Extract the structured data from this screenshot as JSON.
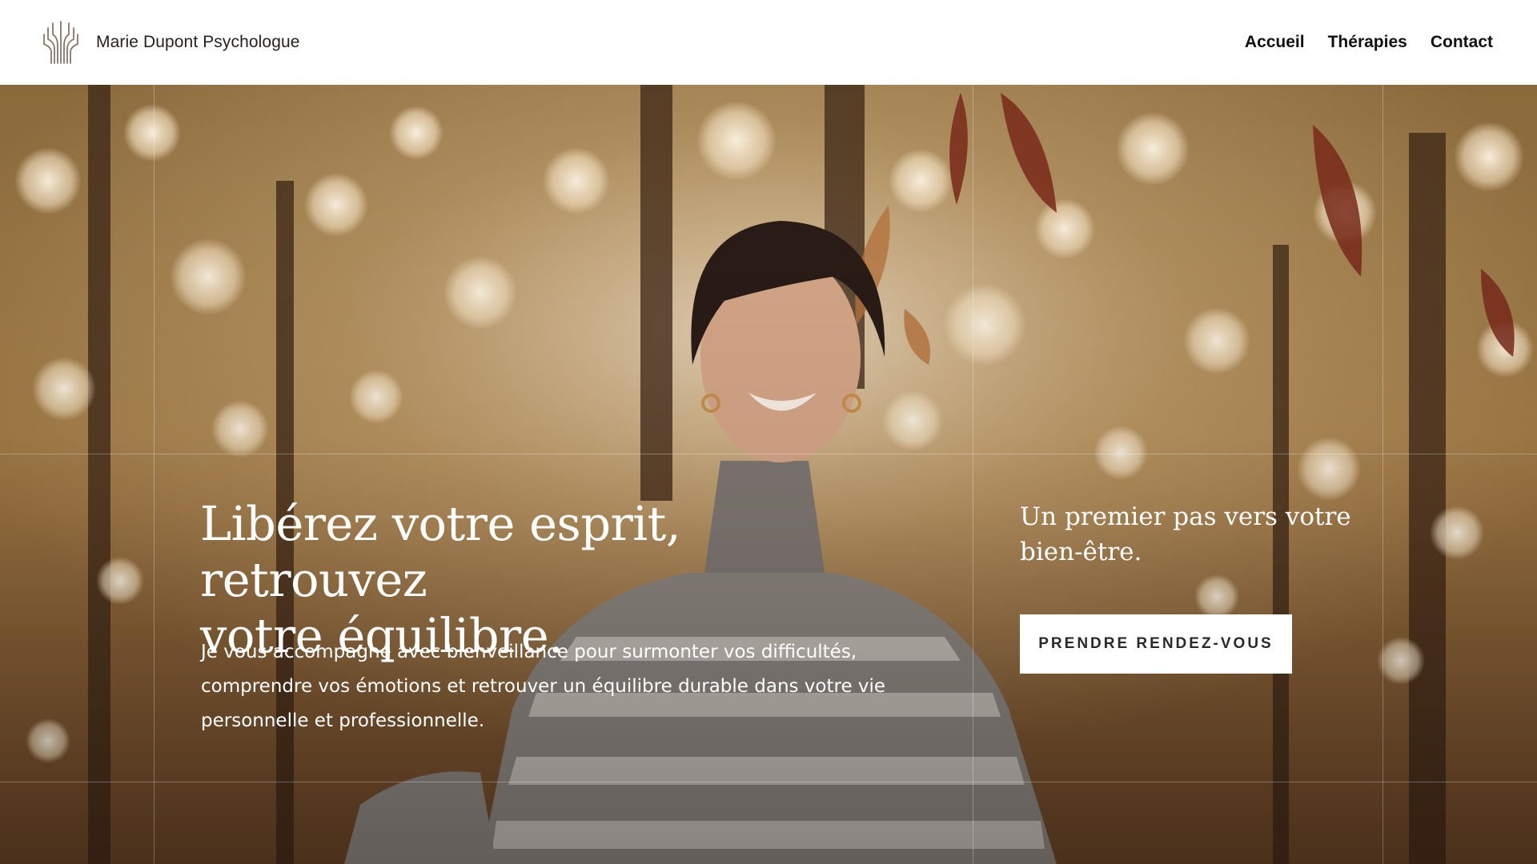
{
  "header": {
    "brand_name": "Marie Dupont Psychologue",
    "logo_icon": "tree-branches-logo-icon",
    "nav": [
      {
        "label": "Accueil"
      },
      {
        "label": "Thérapies"
      },
      {
        "label": "Contact"
      }
    ]
  },
  "hero": {
    "background": "autumn-forest-woman-smiling-photo",
    "title_line1": "Libérez votre esprit, retrouvez",
    "title_line2": "votre équilibre.",
    "text": "Je vous accompagne avec bienveillance pour surmonter vos difficultés, comprendre vos émotions et retrouver un équilibre durable dans votre vie personnelle et professionnelle.",
    "subheading_line1": "Un premier pas vers votre",
    "subheading_line2": "bien-être.",
    "cta_label": "PRENDRE RENDEZ-VOUS"
  },
  "colors": {
    "header_bg": "#ffffff",
    "logo": "#8b7565",
    "text_dark": "#2a211d",
    "hero_text": "#ffffff",
    "button_bg": "#ffffff"
  }
}
